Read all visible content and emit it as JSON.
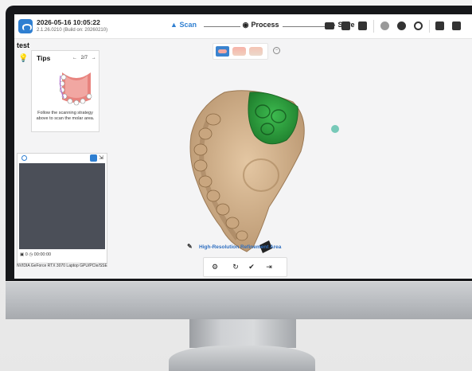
{
  "titlebar": {
    "datetime": "2026-05-16 10:05:22",
    "version": "2.1.26.0210 (Build on: 20260210)"
  },
  "steps": [
    {
      "label": "Scan",
      "icon": "scan-icon",
      "active": true,
      "color": "#2f7fd1"
    },
    {
      "label": "Process",
      "icon": "process-icon",
      "active": false,
      "color": "#222222"
    },
    {
      "label": "Save",
      "icon": "save-icon",
      "active": false,
      "color": "#222222"
    }
  ],
  "project": {
    "name": "test"
  },
  "tips": {
    "title": "Tips",
    "page": "2/7",
    "prev": "←",
    "next": "→",
    "text": "Follow the scanning strategy above to scan the molar area."
  },
  "camera": {
    "time": "00:00:00"
  },
  "gpu": "NVIDIA GeForce RTX 3070 Laptop GPU/PCIe/SSE",
  "refine": {
    "label": "High-Resolution Refinement Area"
  },
  "colors": {
    "accent": "#2f7fd1",
    "model": "#d6b692",
    "highlight": "#2f9a3f",
    "camera_bg": "#4b4f58"
  }
}
